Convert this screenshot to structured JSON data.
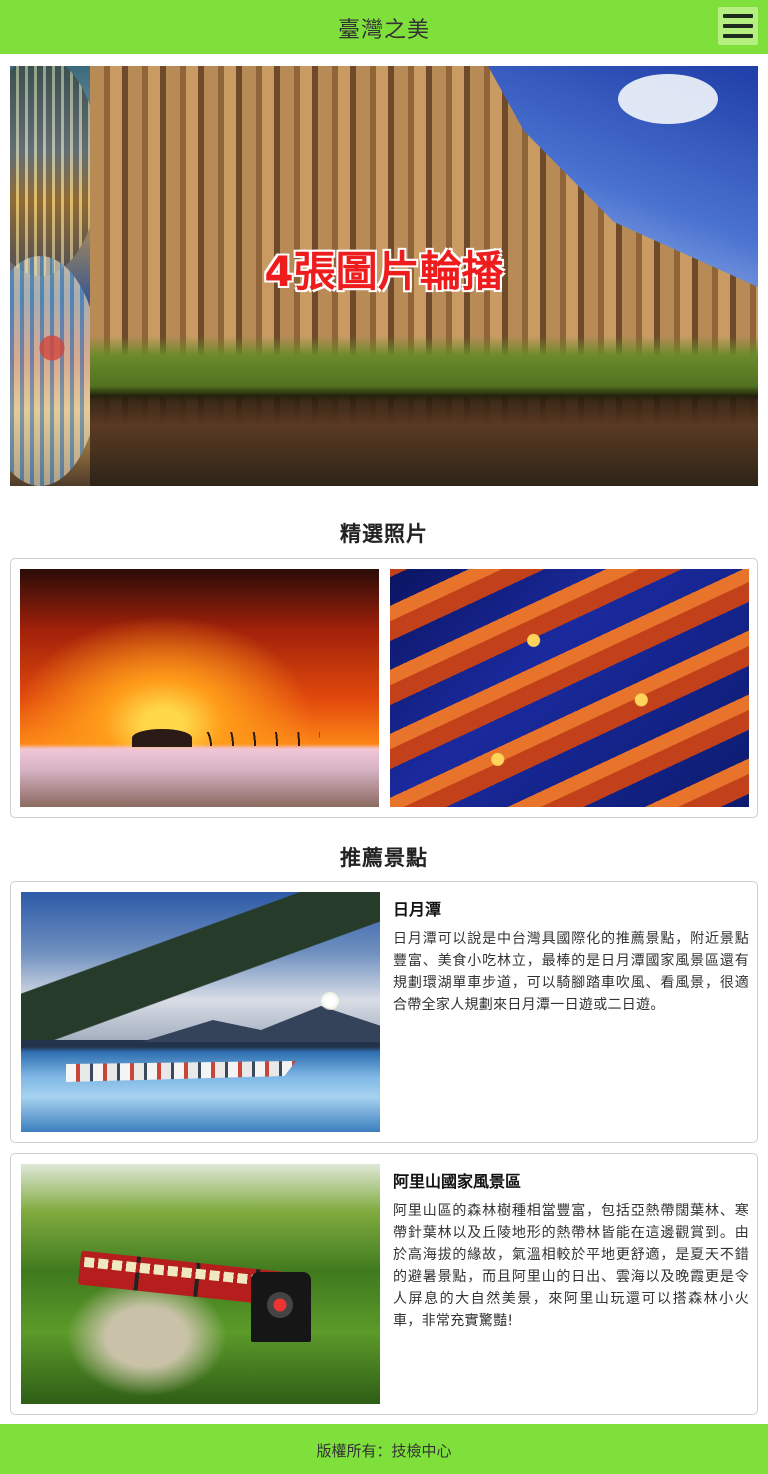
{
  "header": {
    "title": "臺灣之美"
  },
  "carousel": {
    "caption": "4張圖片輪播"
  },
  "featured": {
    "title": "精選照片"
  },
  "recommended": {
    "title": "推薦景點",
    "items": [
      {
        "name": "日月潭",
        "description": "日月潭可以說是中台灣具國際化的推薦景點，附近景點豐富、美食小吃林立，最棒的是日月潭國家風景區還有規劃環湖單車步道，可以騎腳踏車吹風、看風景，很適合帶全家人規劃來日月潭一日遊或二日遊。"
      },
      {
        "name": "阿里山國家風景區",
        "description": "阿里山區的森林樹種相當豐富，包括亞熱帶闊葉林、寒帶針葉林以及丘陵地形的熱帶林皆能在這邊觀賞到。由於高海拔的緣故，氣溫相較於平地更舒適，是夏天不錯的避暑景點，而且阿里山的日出、雲海以及晚霞更是令人屏息的大自然美景，來阿里山玩還可以搭森林小火車，非常充實驚豔!"
      }
    ]
  },
  "footer": {
    "text": "版權所有：技檢中心"
  },
  "colors": {
    "header_bg": "#7fe03b",
    "menu_btn_bg": "#b5ef7f",
    "caption_color": "#ee1c1c",
    "footer_bg": "#7fe03b"
  },
  "icons": {
    "menu": "hamburger-menu-icon"
  }
}
